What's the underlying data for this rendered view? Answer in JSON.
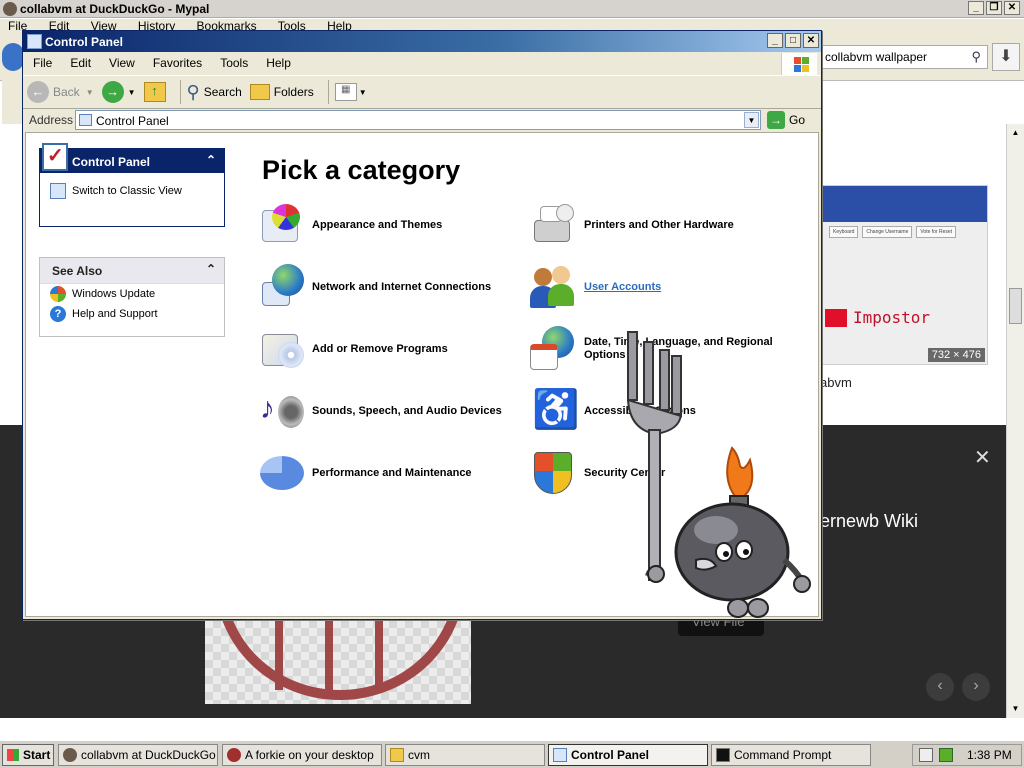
{
  "browser": {
    "title": "collabvm at DuckDuckGo - Mypal",
    "menu": [
      "File",
      "Edit",
      "View",
      "History",
      "Bookmarks",
      "Tools",
      "Help"
    ],
    "search_value": "collabvm wallpaper",
    "thumb_tabs": [
      "Keyboard",
      "Change Username",
      "Vote for Reset"
    ],
    "thumb_impostor": "Impostor",
    "thumb_dims": "732 × 476",
    "thumb_caption": "abvm",
    "panel_title": "ernewb Wiki",
    "view_file": "View File"
  },
  "window": {
    "title": "Control Panel",
    "menu": [
      "File",
      "Edit",
      "View",
      "Favorites",
      "Tools",
      "Help"
    ],
    "toolbar": {
      "back": "Back",
      "search": "Search",
      "folders": "Folders"
    },
    "address_label": "Address",
    "address_value": "Control Panel",
    "go": "Go"
  },
  "sidepanel": {
    "control_panel": {
      "title": "Control Panel",
      "link": "Switch to Classic View"
    },
    "see_also": {
      "title": "See Also",
      "items": [
        "Windows Update",
        "Help and Support"
      ]
    }
  },
  "main": {
    "heading": "Pick a category",
    "categories": [
      {
        "label": "Appearance and Themes",
        "icon": "appearance-icon"
      },
      {
        "label": "Printers and Other Hardware",
        "icon": "printer-icon"
      },
      {
        "label": "Network and Internet Connections",
        "icon": "network-icon"
      },
      {
        "label": "User Accounts",
        "icon": "user-accounts-icon"
      },
      {
        "label": "Add or Remove Programs",
        "icon": "add-remove-icon"
      },
      {
        "label": "Date, Time, Language, and Regional Options",
        "icon": "date-time-icon"
      },
      {
        "label": "Sounds, Speech, and Audio Devices",
        "icon": "sounds-icon"
      },
      {
        "label": "Accessibility Options",
        "icon": "accessibility-icon"
      },
      {
        "label": "Performance and Maintenance",
        "icon": "performance-icon"
      },
      {
        "label": "Security Center",
        "icon": "security-icon"
      }
    ]
  },
  "taskbar": {
    "start": "Start",
    "tasks": [
      "collabvm at DuckDuckGo ...",
      "A forkie on your desktop",
      "cvm",
      "Control Panel",
      "Command Prompt"
    ],
    "clock": "1:38 PM"
  },
  "colors": {
    "title_blue": "#0a246a",
    "link_blue": "#2a6cc0",
    "taskbar": "#d4d0c8"
  }
}
